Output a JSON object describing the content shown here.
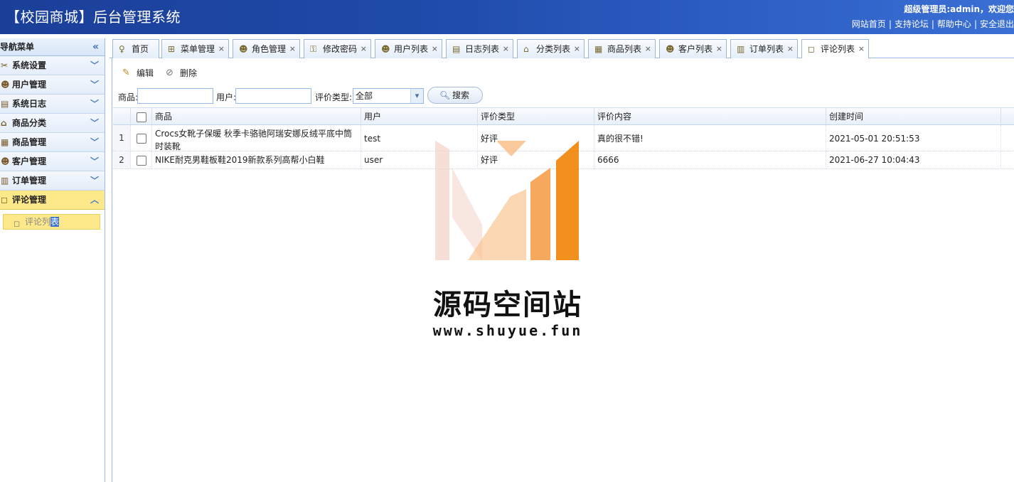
{
  "header": {
    "title": "【校园商城】后台管理系统",
    "user_text": "超级管理员:admin，欢迎您",
    "links": [
      "网站首页",
      "支持论坛",
      "帮助中心",
      "安全退出"
    ]
  },
  "sidebar": {
    "title": "导航菜单",
    "items": [
      {
        "label": "系统设置",
        "icon": "tools-icon"
      },
      {
        "label": "用户管理",
        "icon": "users-icon"
      },
      {
        "label": "系统日志",
        "icon": "log-icon"
      },
      {
        "label": "商品分类",
        "icon": "category-icon"
      },
      {
        "label": "商品管理",
        "icon": "goods-icon"
      },
      {
        "label": "客户管理",
        "icon": "customer-icon"
      },
      {
        "label": "订单管理",
        "icon": "order-icon"
      },
      {
        "label": "评论管理",
        "icon": "comment-icon",
        "expanded": true
      }
    ],
    "sub_items": [
      {
        "label_prefix": "评论列",
        "label_selected": "表"
      }
    ]
  },
  "tabs": [
    {
      "label": "首页",
      "closable": false
    },
    {
      "label": "菜单管理",
      "closable": true
    },
    {
      "label": "角色管理",
      "closable": true
    },
    {
      "label": "修改密码",
      "closable": true
    },
    {
      "label": "用户列表",
      "closable": true
    },
    {
      "label": "日志列表",
      "closable": true
    },
    {
      "label": "分类列表",
      "closable": true
    },
    {
      "label": "商品列表",
      "closable": true
    },
    {
      "label": "客户列表",
      "closable": true
    },
    {
      "label": "订单列表",
      "closable": true
    },
    {
      "label": "评论列表",
      "closable": true,
      "active": true
    }
  ],
  "toolbar": {
    "edit_label": "编辑",
    "delete_label": "删除"
  },
  "filters": {
    "goods_label": "商品:",
    "goods_value": "",
    "user_label": "用户:",
    "user_value": "",
    "type_label": "评价类型:",
    "type_value": "全部",
    "search_label": "搜索"
  },
  "grid": {
    "columns": [
      "商品",
      "用户",
      "评价类型",
      "评价内容",
      "创建时间"
    ],
    "rows": [
      {
        "num": "1",
        "goods": "Crocs女靴子保暖 秋季卡骆驰阿瑞安娜反绒平底中筒时装靴",
        "user": "test",
        "type": "好评",
        "content": "真的很不错!",
        "created": "2021-05-01 20:51:53"
      },
      {
        "num": "2",
        "goods": "NIKE耐克男鞋板鞋2019新款系列高帮小白鞋",
        "user": "user",
        "type": "好评",
        "content": "6666",
        "created": "2021-06-27 10:04:43"
      }
    ]
  },
  "watermark": {
    "name": "源码空间站",
    "url": "www.shuyue.fun",
    "colors": [
      "#f0c8b8",
      "#f5a04a",
      "#f08a10"
    ]
  }
}
